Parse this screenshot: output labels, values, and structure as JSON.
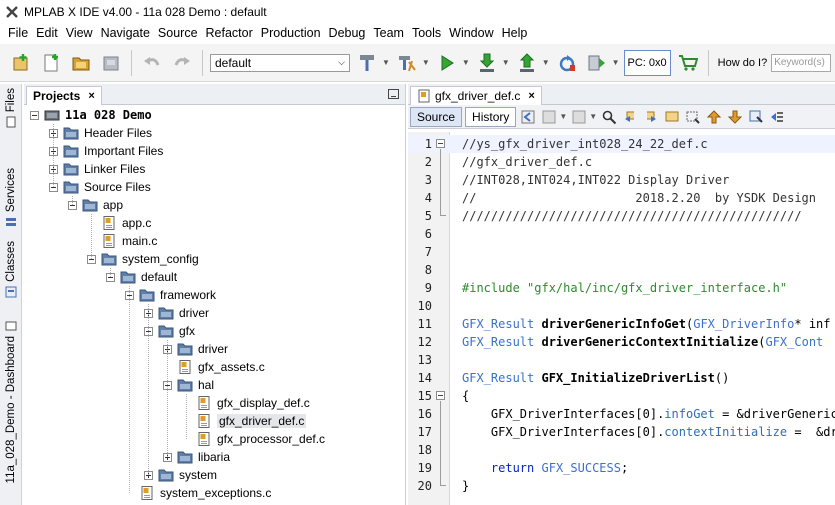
{
  "window": {
    "title": "MPLAB X IDE v4.00 - 11a 028 Demo : default"
  },
  "menu": [
    "File",
    "Edit",
    "View",
    "Navigate",
    "Source",
    "Refactor",
    "Production",
    "Debug",
    "Team",
    "Tools",
    "Window",
    "Help"
  ],
  "toolbar": {
    "config_value": "default",
    "pc_label": "PC: 0x0",
    "howdoi_label": "How do I?",
    "keyword_placeholder": "Keyword(s)"
  },
  "side_tabs": [
    "Files",
    "Services",
    "Classes",
    "11a_028_Demo - Dashboard"
  ],
  "projects": {
    "tab_label": "Projects",
    "close_glyph": "×",
    "tree": [
      {
        "label": "11a 028 Demo",
        "bold": true
      },
      {
        "label": "Header Files"
      },
      {
        "label": "Important Files"
      },
      {
        "label": "Linker Files"
      },
      {
        "label": "Source Files"
      },
      {
        "label": "app"
      },
      {
        "label": "app.c"
      },
      {
        "label": "main.c"
      },
      {
        "label": "system_config"
      },
      {
        "label": "default"
      },
      {
        "label": "framework"
      },
      {
        "label": "driver"
      },
      {
        "label": "gfx"
      },
      {
        "label": "driver"
      },
      {
        "label": "gfx_assets.c"
      },
      {
        "label": "hal"
      },
      {
        "label": "gfx_display_def.c"
      },
      {
        "label": "gfx_driver_def.c",
        "selected": true
      },
      {
        "label": "gfx_processor_def.c"
      },
      {
        "label": "libaria"
      },
      {
        "label": "system"
      },
      {
        "label": "system_exceptions.c"
      }
    ]
  },
  "editor": {
    "tab_label": "gfx_driver_def.c",
    "close_glyph": "×",
    "view_source": "Source",
    "view_history": "History",
    "lines": [
      {
        "n": "1",
        "text": "//ys_gfx_driver_int028_24_22_def.c"
      },
      {
        "n": "2",
        "text": "//gfx_driver_def.c"
      },
      {
        "n": "3",
        "text": "//INT028,INT024,INT022 Display Driver"
      },
      {
        "n": "4",
        "text": "//                      2018.2.20  by YSDK Design"
      },
      {
        "n": "5",
        "text": "///////////////////////////////////////////////"
      },
      {
        "n": "6",
        "text": ""
      },
      {
        "n": "7",
        "text": ""
      },
      {
        "n": "8",
        "text": ""
      },
      {
        "n": "9",
        "text": "#include \"gfx/hal/inc/gfx_driver_interface.h\""
      },
      {
        "n": "10",
        "text": ""
      },
      {
        "n": "11",
        "type": "GFX_Result",
        "fn": "driverGenericInfoGet",
        "rest": "(",
        "type2": "GFX_DriverInfo",
        "rest2": "* inf"
      },
      {
        "n": "12",
        "type": "GFX_Result",
        "fn": "driverGenericContextInitialize",
        "rest": "(",
        "type2": "GFX_Cont",
        "rest2": ""
      },
      {
        "n": "13",
        "text": ""
      },
      {
        "n": "14",
        "type": "GFX_Result",
        "fn": "GFX_InitializeDriverList",
        "rest": "()",
        "type2": "",
        "rest2": ""
      },
      {
        "n": "15",
        "text": "{"
      },
      {
        "n": "16",
        "pre": "    GFX_DriverInterfaces[0].",
        "field": "infoGet",
        "post": " = &driverGenericI"
      },
      {
        "n": "17",
        "pre": "    GFX_DriverInterfaces[0].",
        "field": "contextInitialize",
        "post": " =  &dri"
      },
      {
        "n": "18",
        "text": ""
      },
      {
        "n": "19",
        "kw": "return",
        "const": "GFX_SUCCESS",
        "post": ";"
      },
      {
        "n": "20",
        "text": "}"
      }
    ]
  },
  "colors": {
    "accent": "#3b6fd1",
    "preprocessor": "#2e8a2e",
    "keyword": "#0a22d0"
  },
  "icons": [
    "app-logo-icon",
    "new-project-icon",
    "new-file-icon",
    "open-project-icon",
    "close-project-icon",
    "undo-icon",
    "redo-icon",
    "build-icon",
    "clean-build-icon",
    "run-icon",
    "debug-icon",
    "program-device-icon",
    "reset-icon",
    "make-icon",
    "cart-icon",
    "folder-icon",
    "file-icon",
    "chip-icon"
  ]
}
